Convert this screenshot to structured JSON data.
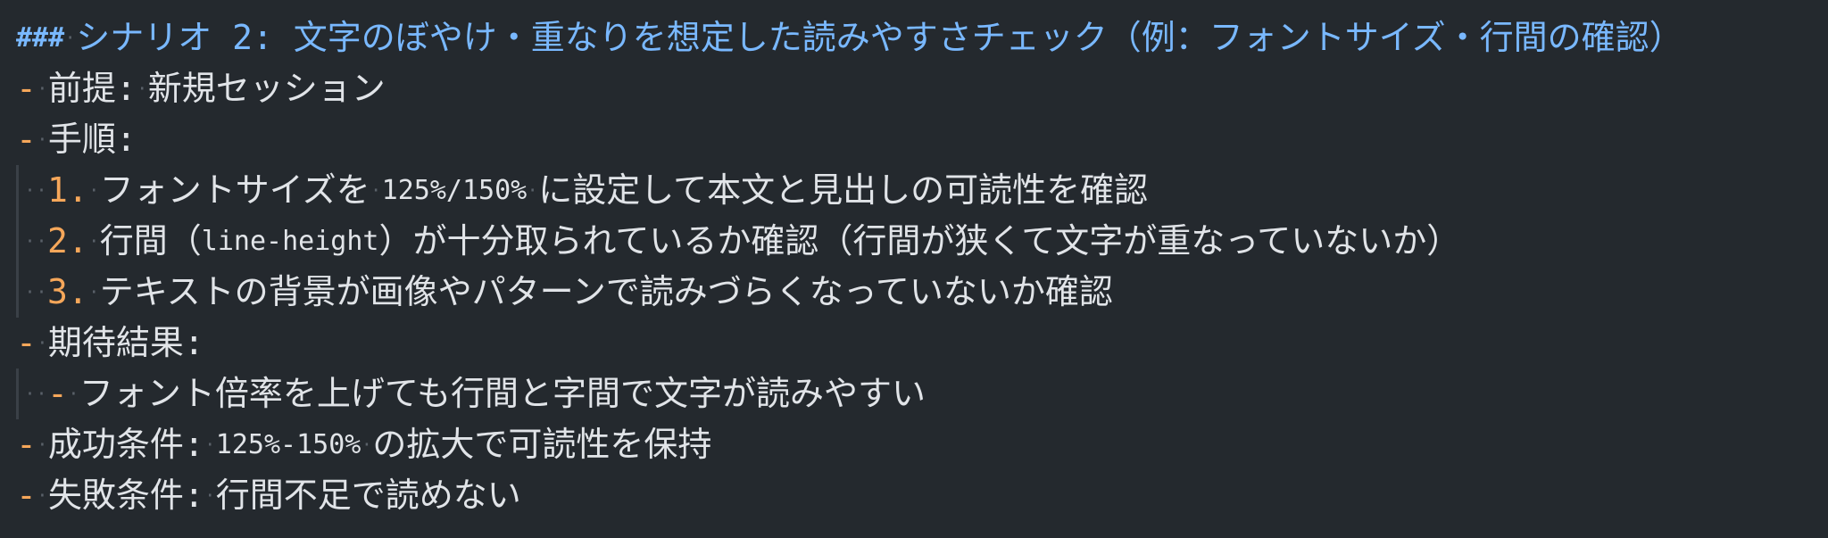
{
  "editor": {
    "heading": {
      "marker": "###",
      "text": "シナリオ 2: 文字のぼやけ・重なりを想定した読みやすさチェック（例：フォントサイズ・行間の確認）"
    },
    "precondition": {
      "bullet": "-",
      "label": "前提:",
      "value": "新規セッション"
    },
    "steps": {
      "bullet": "-",
      "label": "手順:",
      "items": [
        {
          "num": "1.",
          "pre": "フォントサイズを",
          "code": "125%/150%",
          "post": "に設定して本文と見出しの可読性を確認"
        },
        {
          "num": "2.",
          "pre": "行間（",
          "code": "line-height",
          "post": "）が十分取られているか確認（行間が狭くて文字が重なっていないか）"
        },
        {
          "num": "3.",
          "pre": "テキストの背景が画像やパターンで読みづらくなっていないか確認",
          "code": "",
          "post": ""
        }
      ]
    },
    "expected": {
      "bullet": "-",
      "label": "期待結果:",
      "items": [
        {
          "bullet": "-",
          "text": "フォント倍率を上げても行間と字間で文字が読みやすい"
        }
      ]
    },
    "success": {
      "bullet": "-",
      "label": "成功条件:",
      "code": "125%-150%",
      "text": "の拡大で可読性を保持"
    },
    "failure": {
      "bullet": "-",
      "label": "失敗条件:",
      "text": "行間不足で読めない"
    }
  },
  "colors": {
    "background": "#24292e",
    "heading": "#79b8ff",
    "bullet": "#f6a75a",
    "text": "#e1e4e8",
    "whitespace": "#5a6169"
  }
}
